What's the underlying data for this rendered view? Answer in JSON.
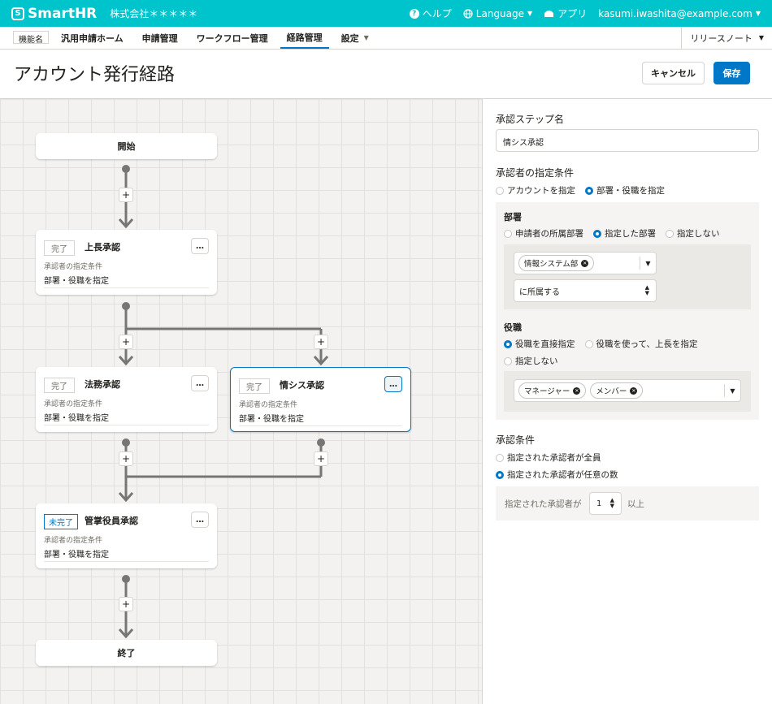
{
  "header": {
    "brand": "SmartHR",
    "company": "株式会社＊＊＊＊＊",
    "help": "ヘルプ",
    "language": "Language",
    "apps": "アプリ",
    "user_email": "kasumi.iwashita@example.com"
  },
  "nav": {
    "feature_badge": "機能名",
    "tabs": [
      "汎用申請ホーム",
      "申請管理",
      "ワークフロー管理",
      "経路管理",
      "設定"
    ],
    "active_tab": "経路管理",
    "release_notes": "リリースノート"
  },
  "page": {
    "title": "アカウント発行経路",
    "cancel_label": "キャンセル",
    "save_label": "保存"
  },
  "flow": {
    "start": "開始",
    "end": "終了",
    "plus": "+",
    "more": "…",
    "steps": [
      {
        "status": "完了",
        "name": "上長承認",
        "cond_label": "承認者の指定条件",
        "cond_value": "部署・役職を指定"
      },
      {
        "status": "完了",
        "name": "法務承認",
        "cond_label": "承認者の指定条件",
        "cond_value": "部署・役職を指定"
      },
      {
        "status": "完了",
        "name": "情シス承認",
        "cond_label": "承認者の指定条件",
        "cond_value": "部署・役職を指定"
      },
      {
        "status": "未完了",
        "name": "管掌役員承認",
        "cond_label": "承認者の指定条件",
        "cond_value": "部署・役職を指定"
      }
    ]
  },
  "panel": {
    "step_name_label": "承認ステップ名",
    "step_name_value": "情シス承認",
    "approver_label": "承認者の指定条件",
    "approver_options": [
      "アカウントを指定",
      "部署・役職を指定"
    ],
    "approver_selected": 1,
    "dept_label": "部署",
    "dept_options": [
      "申請者の所属部署",
      "指定した部署",
      "指定しない"
    ],
    "dept_selected": 1,
    "dept_chip": "情報システム部",
    "dept_relation": "に所属する",
    "role_label": "役職",
    "role_options": [
      "役職を直接指定",
      "役職を使って、上長を指定",
      "指定しない"
    ],
    "role_selected": 0,
    "role_chips": [
      "マネージャー",
      "メンバー"
    ],
    "approval_label": "承認条件",
    "approval_options": [
      "指定された承認者が全員",
      "指定された承認者が任意の数"
    ],
    "approval_selected": 1,
    "count_prefix": "指定された承認者が",
    "count_value": "1",
    "count_suffix": "以上"
  },
  "colors": {
    "brand": "#00c4cc",
    "primary": "#0077c7",
    "text": "#23221e",
    "muted": "#706d65",
    "connector": "#767676"
  }
}
